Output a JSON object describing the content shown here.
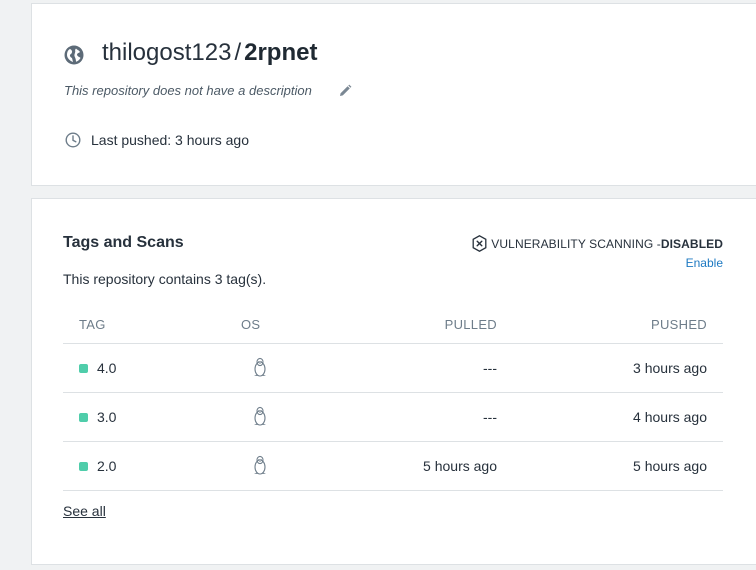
{
  "repo": {
    "namespace": "thilogost123",
    "separator": "/",
    "name": "2rpnet",
    "description": "This repository does not have a description",
    "last_pushed": "Last pushed: 3 hours ago"
  },
  "tags_card": {
    "heading": "Tags and Scans",
    "vulnerability_label": "VULNERABILITY SCANNING - ",
    "vulnerability_status": "DISABLED",
    "enable_label": "Enable",
    "tag_count_text": "This repository contains 3 tag(s).",
    "columns": {
      "tag": "TAG",
      "os": "OS",
      "pulled": "PULLED",
      "pushed": "PUSHED"
    },
    "rows": [
      {
        "tag": "4.0",
        "os_icon": "linux-icon",
        "pulled": "---",
        "pushed": "3 hours ago"
      },
      {
        "tag": "3.0",
        "os_icon": "linux-icon",
        "pulled": "---",
        "pushed": "4 hours ago"
      },
      {
        "tag": "2.0",
        "os_icon": "linux-icon",
        "pulled": "5 hours ago",
        "pushed": "5 hours ago"
      }
    ],
    "see_all_label": "See all"
  },
  "colors": {
    "tag_dot": "#4fcdaa",
    "link": "#1d79c2",
    "text": "#27313c",
    "muted": "#6e7d8a",
    "border": "#dde1e4"
  }
}
